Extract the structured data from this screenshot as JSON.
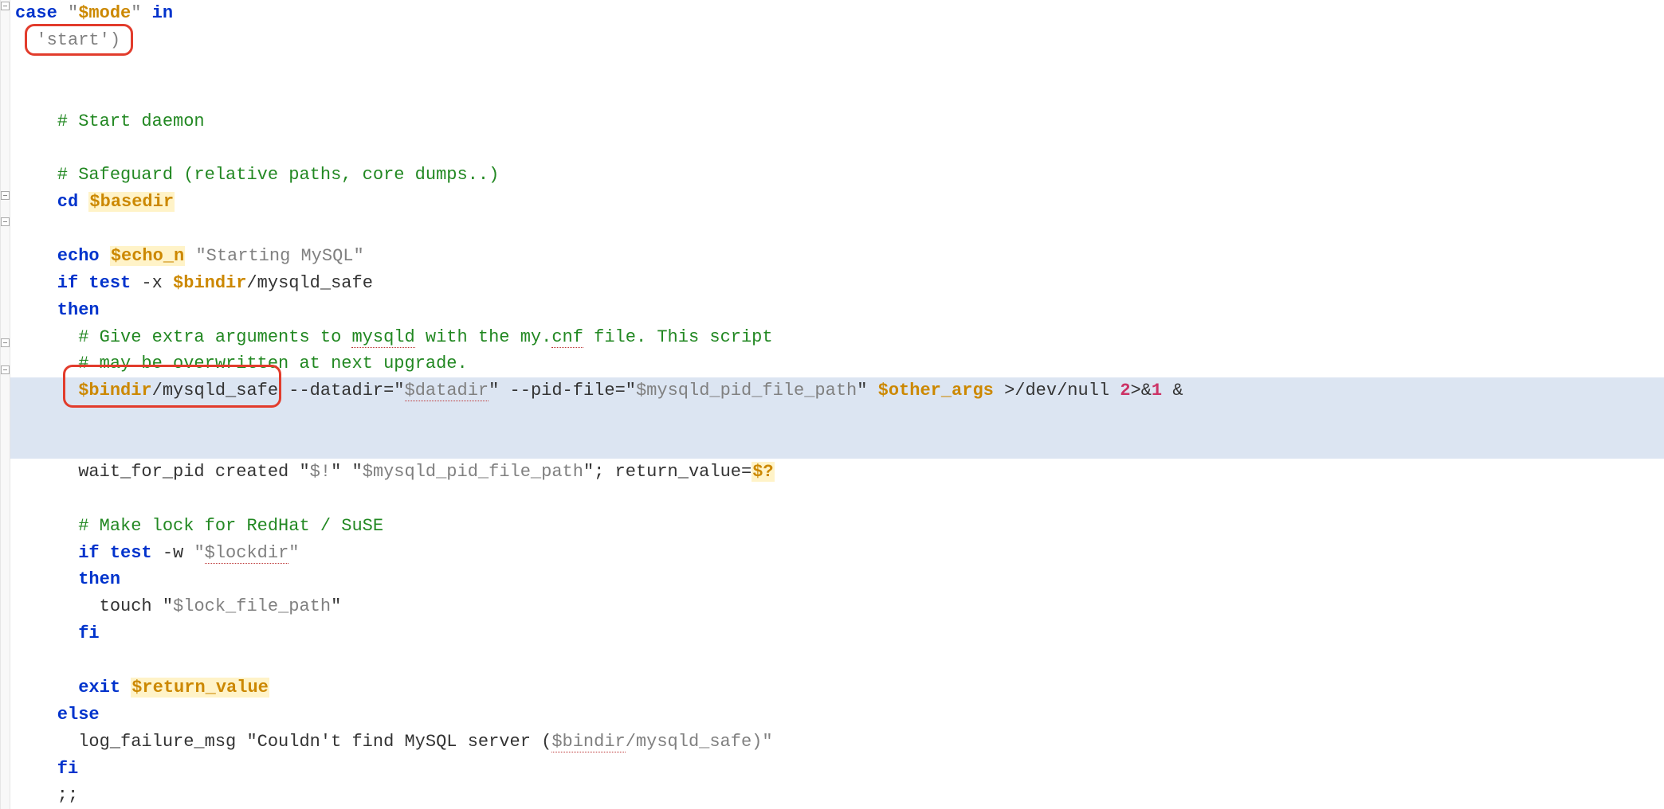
{
  "code": {
    "l01_case": "case",
    "l01_q1": " \"",
    "l01_var": "$mode",
    "l01_q2": "\" ",
    "l01_in": "in",
    "l02": "  'start')",
    "l03": "    # Start daemon",
    "l04": "",
    "l05": "    # Safeguard (relative paths, core dumps..)",
    "l06_cd": "    cd",
    "l06_sp": " ",
    "l06_var": "$basedir",
    "l07": "",
    "l08_echo": "    echo",
    "l08_sp": " ",
    "l08_var": "$echo_n",
    "l08_sp2": " ",
    "l08_str": "\"Starting MySQL\"",
    "l09_if": "    if test",
    "l09_x": " -x ",
    "l09_var": "$bindir",
    "l09_rest": "/mysqld_safe",
    "l10": "    then",
    "l11_a": "      # Give extra arguments to ",
    "l11_b": "mysqld",
    "l11_c": " with the my.",
    "l11_d": "cnf",
    "l11_e": " file. This script",
    "l12": "      # may be overwritten at next upgrade.",
    "l13_pad": "      ",
    "l13_v1": "$bindir",
    "l13_t1": "/mysqld_safe ",
    "l13_t2": "--datadir=\"",
    "l13_dd": "$datadir",
    "l13_t3": "\" --pid-file=\"",
    "l13_t4": "$mysqld_pid_file_path",
    "l13_t5": "\" ",
    "l13_v2": "$other_args",
    "l13_t6": " >/dev/null ",
    "l13_n2": "2",
    "l13_amp": ">&",
    "l13_n1": "1",
    "l13_bg": " &",
    "l14_a": "      wait_for_pid created \"",
    "l14_b": "$!",
    "l14_c": "\" \"",
    "l14_d": "$mysqld_pid_file_path",
    "l14_e": "\"",
    "l14_f": "; return_value=",
    "l14_g": "$?",
    "l15": "",
    "l16": "      # Make lock for RedHat / SuSE",
    "l17_if": "      if test",
    "l17_w": " -w ",
    "l17_q1": "\"",
    "l17_var": "$lockdir",
    "l17_q2": "\"",
    "l18": "      then",
    "l19_a": "        touch \"",
    "l19_b": "$lock_file_path",
    "l19_c": "\"",
    "l20": "      fi",
    "l21": "",
    "l22_exit": "      exit",
    "l22_sp": " ",
    "l22_var": "$return_value",
    "l23": "    else",
    "l24_a": "      log_failure_msg \"Couldn't find MySQL server (",
    "l24_b": "$bindir",
    "l24_c": "/mysqld_safe)\"",
    "l25": "    fi",
    "l26": "    ;;"
  }
}
